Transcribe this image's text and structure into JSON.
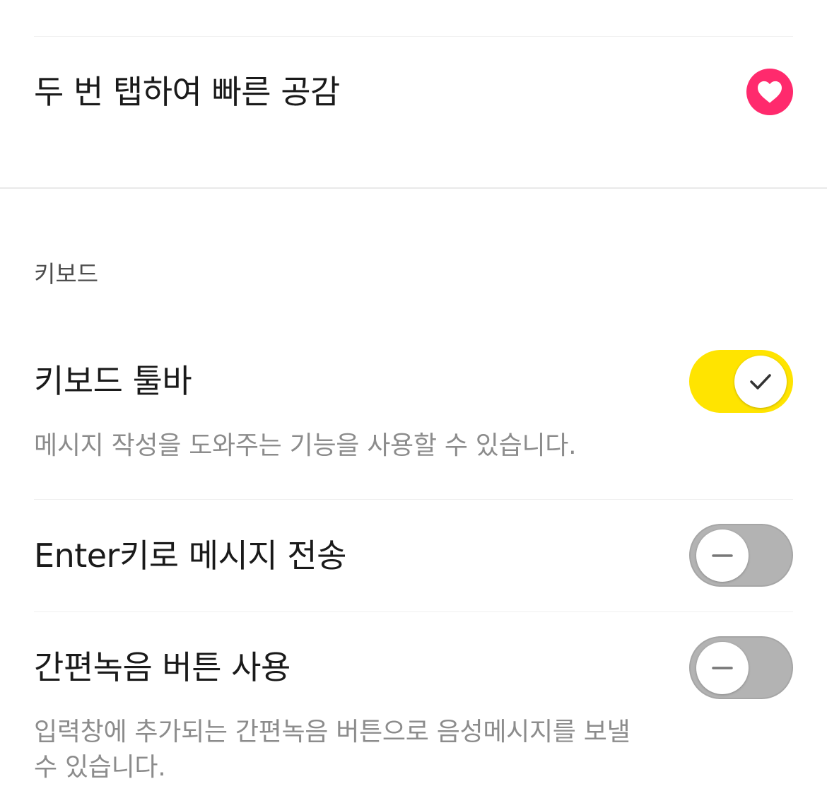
{
  "quick_like": {
    "label": "두 번 탭하여 빠른 공감",
    "icon": "heart-icon",
    "accent_color": "#ff2a6d"
  },
  "keyboard_section": {
    "header": "키보드",
    "toolbar": {
      "label": "키보드 툴바",
      "description": "메시지 작성을 도와주는 기능을 사용할 수 있습니다.",
      "enabled": true,
      "toggle_color": "#ffe400"
    },
    "enter_send": {
      "label": "Enter키로 메시지 전송",
      "enabled": false
    },
    "voice_button": {
      "label": "간편녹음 버튼 사용",
      "description_line1": "입력창에 추가되는 간편녹음 버튼으로 음성메시지를 보낼",
      "description_line2": "수 있습니다.",
      "enabled": false
    }
  }
}
